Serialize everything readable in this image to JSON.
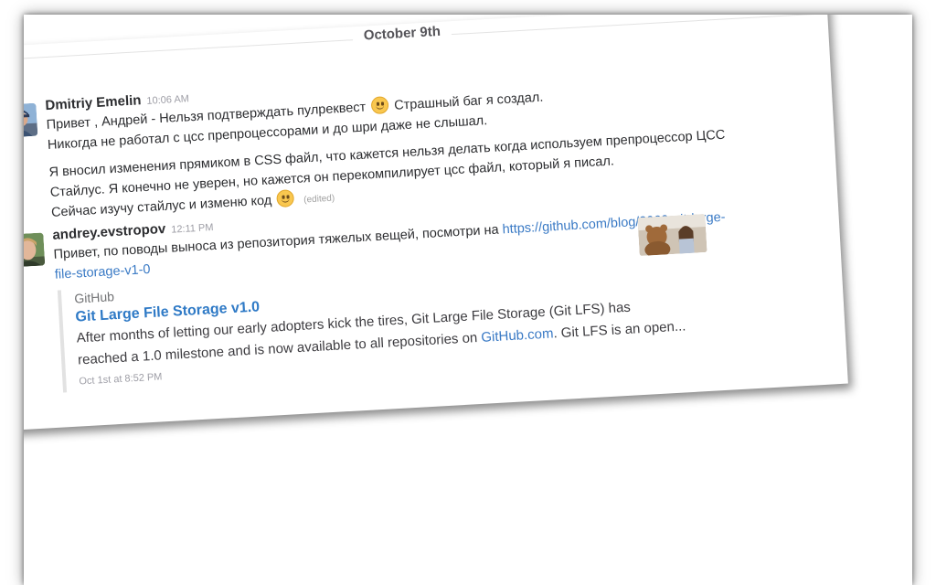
{
  "day_divider": {
    "label": "October 9th"
  },
  "messages": [
    {
      "sender": "Dmitriy Emelin",
      "time": "10:06 AM",
      "avatar_icon": "user-photo-avatar",
      "lines": {
        "l1a": "Привет , Андрей - Нельзя подтверждать пулреквест",
        "l1b": "Страшный баг я создал.",
        "l2": "Никогда не работал с цсс препроцессорами и до шри даже не слышал.",
        "l3": "Я вносил изменения прямиком в CSS файл, что кажется нельзя делать когда используем препроцессор ЦСС",
        "l4": "Стайлус. Я конечно не уверен, но кажется он перекомпилирует цсс файл, который я писал.",
        "l5": "Сейчас изучу стайлус и изменю код",
        "edited": "(edited)"
      },
      "emoji_icon": "slightly-smiling-face-emoji"
    },
    {
      "sender": "andrey.evstropov",
      "time": "12:11 PM",
      "avatar_icon": "user-photo-avatar",
      "text_before_link": "Привет, по поводы выноса из репозитория тяжелых вещей, посмотри на",
      "link_part1": "https://github.com/blog/2069-git-large-",
      "link_part2": "file-storage-v1-0",
      "attachment": {
        "service": "GitHub",
        "title": "Git Large File Storage v1.0",
        "text_line1": "After months of letting our early adopters kick the tires, Git Large File Storage (Git LFS) has",
        "text_line2_before": "reached a 1.0 milestone and is now available to all repositories on",
        "text_line2_link": "GitHub.com",
        "text_line2_after": ". Git LFS is an open...",
        "footer": "Oct 1st at 8:52 PM",
        "thumbnail_icon": "teddy-bear-photo-thumbnail"
      }
    }
  ],
  "colors": {
    "link": "#3a7ac5",
    "attachment_title": "#2f7ac6",
    "attachment_border": "#e2e2e2",
    "timestamp": "#9e9ea6",
    "text": "#2c2d30"
  }
}
